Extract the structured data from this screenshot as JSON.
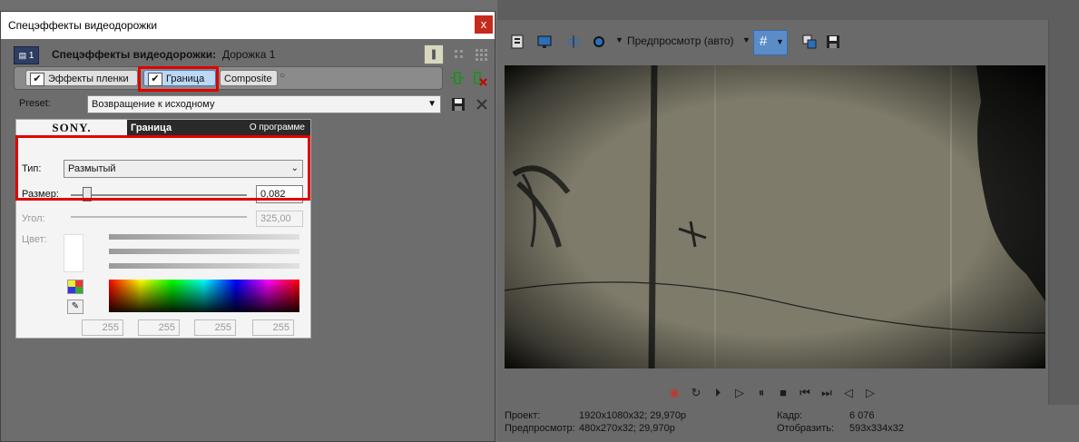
{
  "dialog": {
    "title": "Спецэффекты видеодорожки",
    "close_label": "x",
    "track_badge": "1",
    "header_label": "Спецэффекты видеодорожки:",
    "header_value": "Дорожка 1",
    "effects_chain": [
      {
        "label": "Эффекты пленки",
        "checked": true,
        "selected": false
      },
      {
        "label": "Граница",
        "checked": true,
        "selected": true
      },
      {
        "label": "Composite",
        "checked": false,
        "selected": false
      }
    ],
    "preset_label": "Preset:",
    "preset_value": "Возвращение к исходному",
    "plugin": {
      "brand": "SONY.",
      "name": "Граница",
      "about": "О программе",
      "type_label": "Тип:",
      "type_value": "Размытый",
      "size_label": "Размер:",
      "size_value": "0,082",
      "size_level": 0.082,
      "angle_label": "Угол:",
      "angle_value": "325,00",
      "color_label": "Цвет:",
      "rgba": [
        "255",
        "255",
        "255",
        "255"
      ]
    }
  },
  "toolbar": {
    "preview_mode": "Предпросмотр (авто)"
  },
  "status": {
    "project_label": "Проект:",
    "project_value": "1920x1080x32; 29,970p",
    "preview_label": "Предпросмотр:",
    "preview_value": "480x270x32; 29,970p",
    "frame_label": "Кадр:",
    "frame_value": "6 076",
    "display_label": "Отобразить:",
    "display_value": "593x334x32"
  },
  "colors": {
    "highlight": "#e00000",
    "selected_fx": "#bcd8f5",
    "grid_button": "#5a8cc8",
    "record": "#c0392b"
  }
}
